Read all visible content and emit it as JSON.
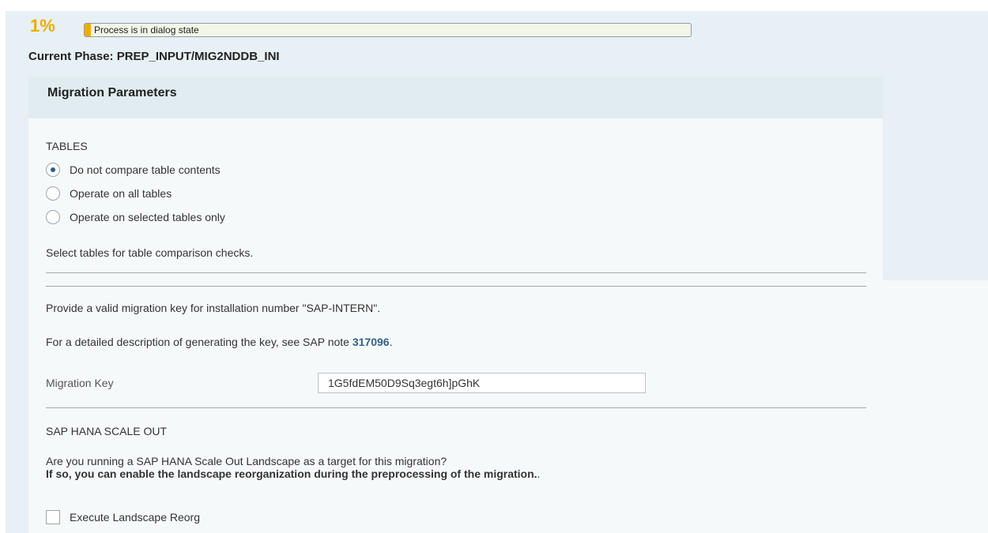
{
  "progress": {
    "percent_text": "1%",
    "fraction": 0.01,
    "status_text": "Process is in dialog state",
    "accent_color": "#f0ab00"
  },
  "phase": {
    "text": "Current Phase: PREP_INPUT/MIG2NDDB_INI"
  },
  "panel": {
    "title": "Migration Parameters"
  },
  "tables": {
    "heading": "TABLES",
    "options": [
      {
        "label": "Do not compare table contents",
        "selected": true
      },
      {
        "label": "Operate on all tables",
        "selected": false
      },
      {
        "label": "Operate on selected tables only",
        "selected": false
      }
    ],
    "hint": "Select tables for table comparison checks."
  },
  "migration_key": {
    "info_line": "Provide a valid migration key for installation number \"SAP-INTERN\".",
    "detail_prefix": "For a detailed description of generating the key, see SAP note ",
    "note_link": "317096",
    "detail_suffix": ".",
    "field_label": "Migration Key",
    "field_value": "1G5fdEM50D9Sq3egt6h]pGhK"
  },
  "scale_out": {
    "heading": "SAP HANA SCALE OUT",
    "question": "Are you running a SAP HANA Scale Out Landscape as a target for this migration?",
    "note_bold": "If so, you can enable the landscape reorganization during the preprocessing of the migration.",
    "note_suffix": ".",
    "checkbox_label": "Execute Landscape Reorg",
    "checkbox_checked": false
  }
}
